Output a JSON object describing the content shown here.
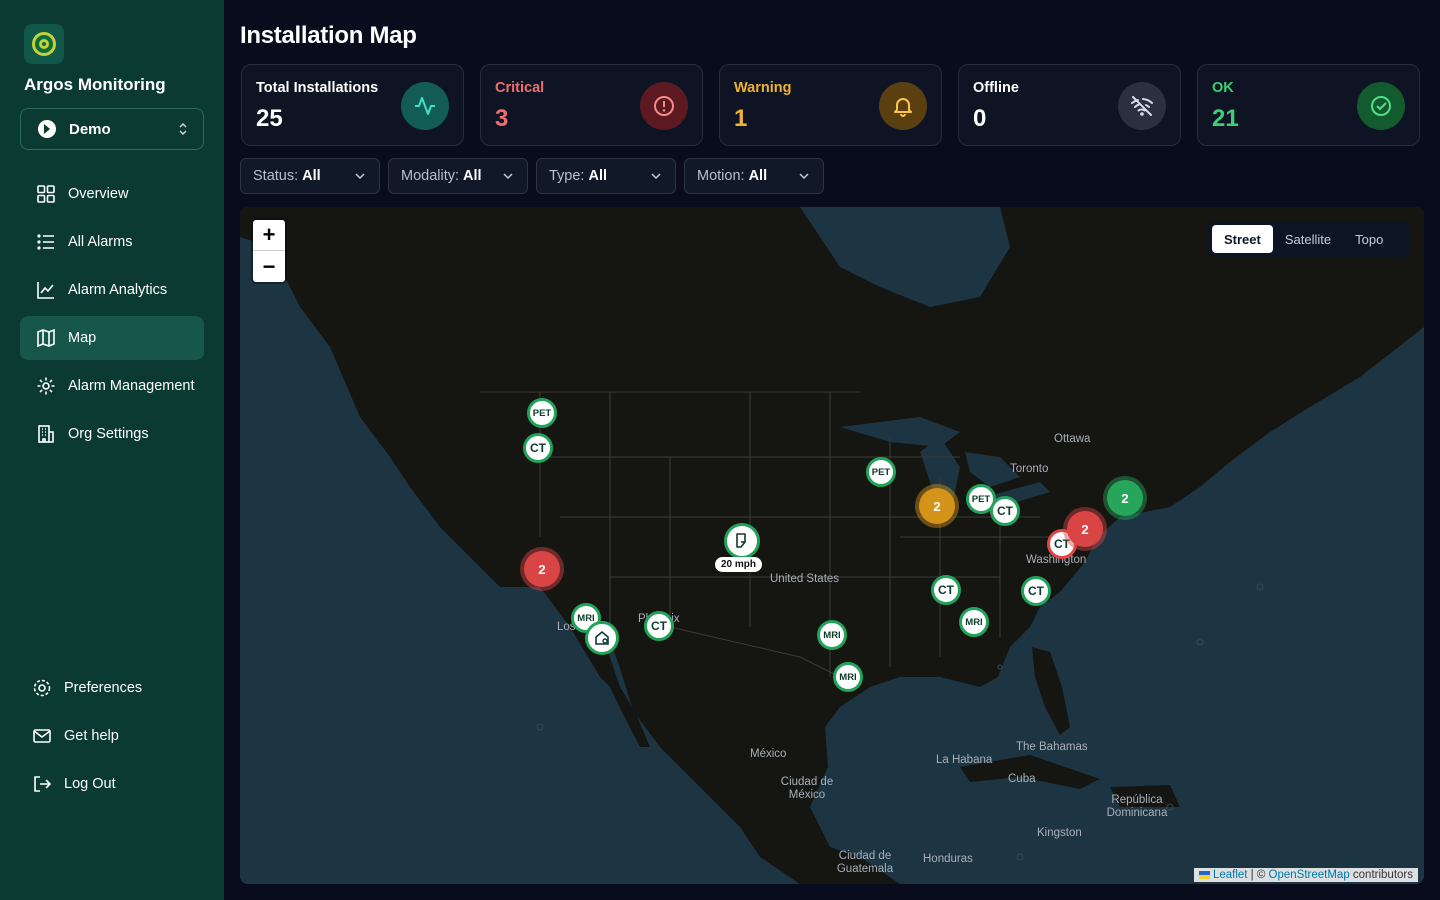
{
  "app": {
    "brand": "Argos Monitoring",
    "org": "Demo"
  },
  "nav": {
    "top": [
      "Overview",
      "All Alarms",
      "Alarm Analytics",
      "Map",
      "Alarm Management",
      "Org Settings"
    ],
    "bottom": [
      "Preferences",
      "Get help",
      "Log Out"
    ],
    "active": "Map"
  },
  "page": {
    "title": "Installation Map"
  },
  "cards": [
    {
      "label": "Total Installations",
      "value": "25",
      "color": "#ffffff",
      "icon": "activity-icon"
    },
    {
      "label": "Critical",
      "value": "3",
      "color": "#f26d6d",
      "icon": "alert-circle-icon"
    },
    {
      "label": "Warning",
      "value": "1",
      "color": "#f0b232",
      "icon": "bell-icon"
    },
    {
      "label": "Offline",
      "value": "0",
      "color": "#ffffff",
      "icon": "wifi-off-icon"
    },
    {
      "label": "OK",
      "value": "21",
      "color": "#3ccf73",
      "icon": "check-circle-icon"
    }
  ],
  "filters": [
    {
      "label": "Status:",
      "value": "All"
    },
    {
      "label": "Modality:",
      "value": "All"
    },
    {
      "label": "Type:",
      "value": "All"
    },
    {
      "label": "Motion:",
      "value": "All"
    }
  ],
  "map": {
    "zoom_in": "+",
    "zoom_out": "−",
    "layers": [
      "Street",
      "Satellite",
      "Topo"
    ],
    "active_layer": "Street",
    "places": {
      "ottawa": "Ottawa",
      "toronto": "Toronto",
      "washington": "Washington",
      "us": "United States",
      "la": "Los",
      "phoenix": "Phoenix",
      "mexico": "México",
      "cdmx": "Ciudad de México",
      "habana": "La Habana",
      "cuba": "Cuba",
      "bahamas": "The Bahamas",
      "rd": "República Dominicana",
      "kingston": "Kingston",
      "guatemala": "Ciudad de Guatemala",
      "honduras": "Honduras"
    },
    "markers": {
      "m_pet_or": "PET",
      "m_ct_or": "CT",
      "m_pet_wi": "PET",
      "m_pet_mi": "PET",
      "m_ct_oh": "CT",
      "m_ct_dc": "CT",
      "m_ct_ky": "CT",
      "m_ct_nc": "CT",
      "m_mri_ga": "MRI",
      "m_mri_ok": "MRI",
      "m_mri_tx": "MRI",
      "m_mri_la": "MRI",
      "m_ct_az": "CT"
    },
    "clusters": {
      "ca": "2",
      "il": "2",
      "ne": "2",
      "nyc": "2"
    },
    "speed": "20 mph",
    "attribution": {
      "leaflet": "Leaflet",
      "sep": " | © ",
      "osm": "OpenStreetMap",
      "rest": " contributors"
    }
  }
}
